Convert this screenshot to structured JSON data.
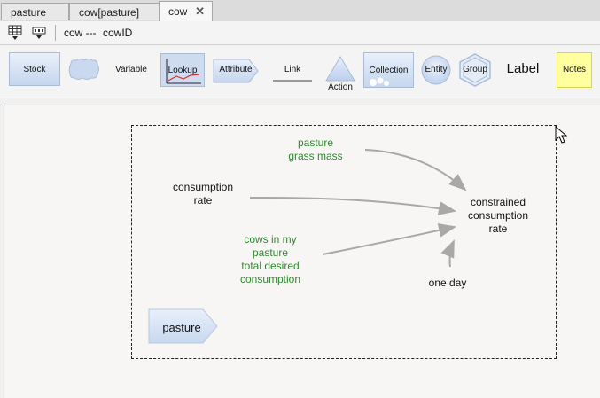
{
  "tabs": [
    {
      "label": "pasture"
    },
    {
      "label": "cow[pasture]"
    },
    {
      "label": "cow"
    }
  ],
  "toolbar": {
    "path_label": "cow ---",
    "id_label": "cowID"
  },
  "palette": {
    "stock": "Stock",
    "variable": "Variable",
    "lookup": "Lookup",
    "attribute": "Attribute",
    "link": "Link",
    "action": "Action",
    "collection": "Collection",
    "entity": "Entity",
    "group": "Group",
    "label": "Label",
    "notes": "Notes"
  },
  "diagram": {
    "nodes": {
      "pasture_grass_mass": {
        "line1": "pasture",
        "line2": "grass mass"
      },
      "consumption_rate": {
        "line1": "consumption",
        "line2": "rate"
      },
      "cows_in_pasture": {
        "line1": "cows in my",
        "line2": "pasture",
        "line3": "total desired",
        "line4": "consumption"
      },
      "constrained_rate": {
        "line1": "constrained",
        "line2": "consumption",
        "line3": "rate"
      },
      "one_day": {
        "label": "one day"
      },
      "pasture_attr": {
        "label": "pasture"
      }
    }
  },
  "colors": {
    "green_text": "#2c8a2c",
    "link_gray": "#a8a8a8"
  }
}
